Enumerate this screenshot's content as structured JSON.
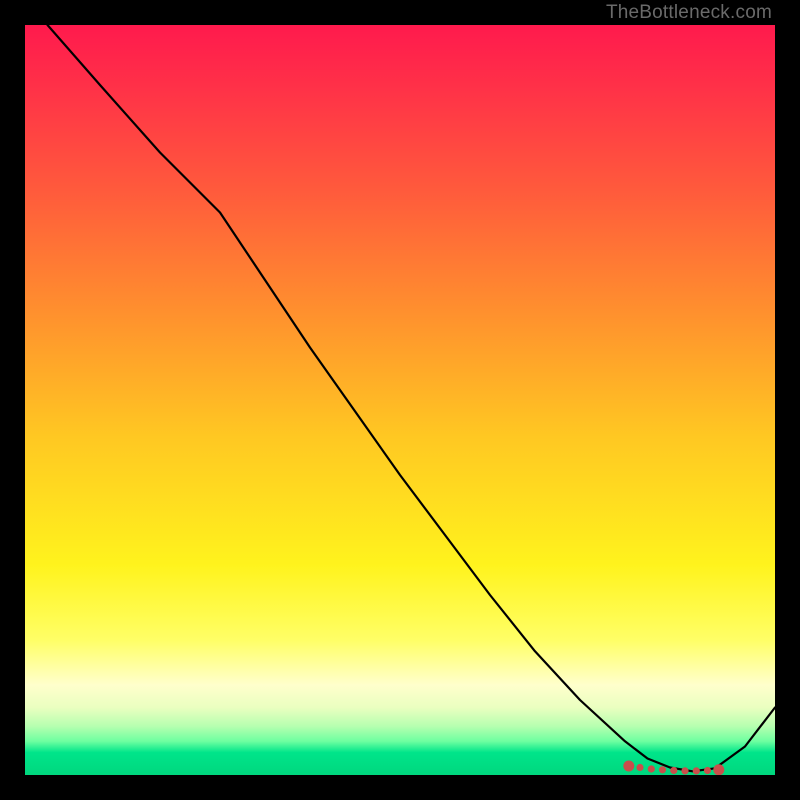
{
  "watermark": "TheBottleneck.com",
  "chart_data": {
    "type": "line",
    "title": "",
    "xlabel": "",
    "ylabel": "",
    "xlim": [
      0,
      100
    ],
    "ylim": [
      0,
      100
    ],
    "series": [
      {
        "name": "curve",
        "x": [
          3,
          10,
          18,
          26,
          32,
          38,
          44,
          50,
          56,
          62,
          68,
          74,
          80,
          83,
          86,
          89,
          92,
          96,
          100
        ],
        "y": [
          100,
          92,
          83,
          75,
          66,
          57,
          48.5,
          40,
          32,
          24,
          16.5,
          10,
          4.5,
          2.2,
          1,
          0.5,
          0.9,
          3.8,
          9
        ]
      }
    ],
    "markers": {
      "name": "optimal-range",
      "x": [
        80.5,
        82,
        83.5,
        85,
        86.5,
        88,
        89.5,
        91,
        92.5
      ],
      "y": [
        1.2,
        1.0,
        0.8,
        0.7,
        0.6,
        0.55,
        0.55,
        0.6,
        0.7
      ]
    },
    "grid": false,
    "legend": false
  },
  "colors": {
    "curve": "#000000",
    "marker": "#c94f4b",
    "gradient_top": "#ff1a4d",
    "gradient_bottom": "#00d77e"
  }
}
